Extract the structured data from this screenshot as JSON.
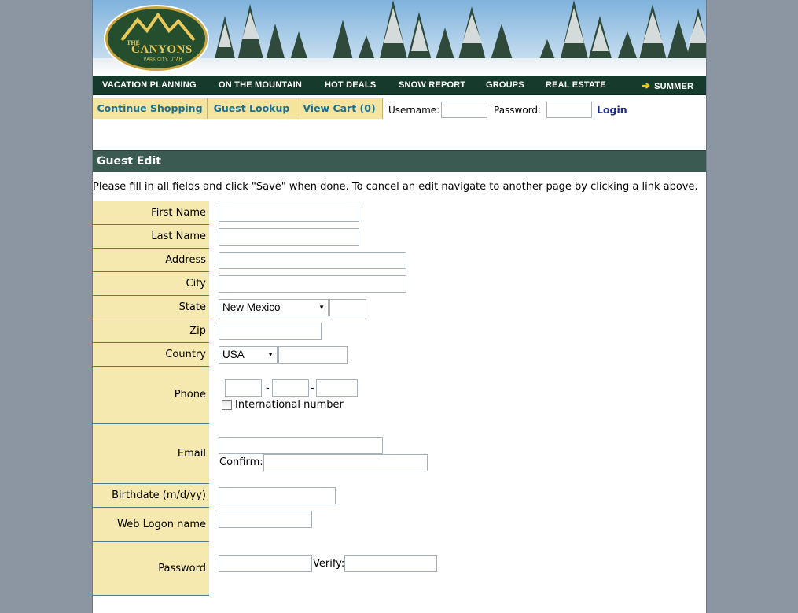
{
  "logo": {
    "the": "THE",
    "name": "CANYONS",
    "sub": "PARK CITY, UTAH"
  },
  "nav": {
    "items": [
      "VACATION PLANNING",
      "ON THE MOUNTAIN",
      "HOT DEALS",
      "SNOW REPORT",
      "GROUPS",
      "REAL ESTATE"
    ],
    "summer": "SUMMER"
  },
  "subbar": {
    "continue_shopping": "Continue Shopping",
    "guest_lookup": "Guest Lookup",
    "view_cart": "View Cart (0)",
    "username_label": "Username:",
    "password_label": "Password:",
    "login": "Login"
  },
  "section": {
    "title": "Guest Edit",
    "intro": "Please fill in all fields and click \"Save\" when done. To cancel an edit navigate to another page by clicking a link above."
  },
  "form": {
    "first_name": "First Name",
    "last_name": "Last Name",
    "address": "Address",
    "city": "City",
    "state": "State",
    "state_value": "New Mexico",
    "zip": "Zip",
    "country": "Country",
    "country_value": "USA",
    "phone": "Phone",
    "phone_sep": "-",
    "international": "International number",
    "email": "Email",
    "confirm": "Confirm:",
    "birthdate": "Birthdate (m/d/yy)",
    "web_logon": "Web Logon name",
    "password": "Password",
    "verify": "Verify:"
  },
  "colors": {
    "nav_bg": "#163a2c",
    "tab_bg": "#f3e4a0",
    "tab_text": "#1f6e8c",
    "label_bg": "#f5e9b0",
    "section_bg": "#3a5a52",
    "page_bg": "#8b96a2"
  }
}
